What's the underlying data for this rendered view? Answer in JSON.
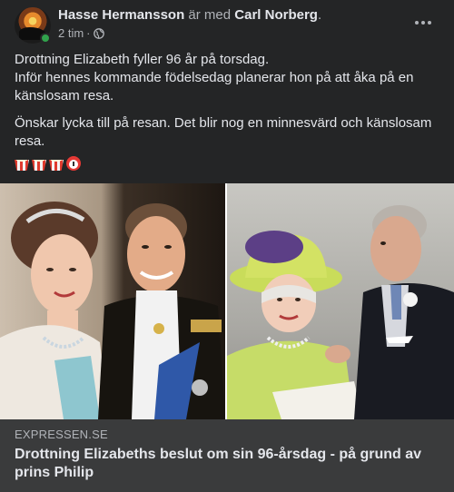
{
  "post": {
    "author": "Hasse Hermansson",
    "with_text": "är med",
    "tagged": "Carl Norberg",
    "tagged_suffix": ".",
    "time": "2 tim",
    "separator": "·",
    "privacy_icon": "globe-icon",
    "paragraphs": [
      "Drottning Elizabeth fyller 96 år på torsdag.",
      "Inför hennes kommande födelsedag planerar hon på att åka på en känslosam resa.",
      "Önskar lycka till på resan. Det blir nog en minnesvärd och känslosam resa."
    ],
    "emojis": [
      "popcorn-icon",
      "popcorn-icon",
      "popcorn-icon",
      "alarm-clock-icon"
    ]
  },
  "link_preview": {
    "source": "EXPRESSEN.SE",
    "headline": "Drottning Elizabeths beslut om sin 96-årsdag - på grund av prins Philip"
  },
  "colors": {
    "background": "#242526",
    "footer": "#3a3b3c",
    "primary_text": "#e4e6eb",
    "secondary_text": "#b0b3b8",
    "online": "#31a24c"
  }
}
